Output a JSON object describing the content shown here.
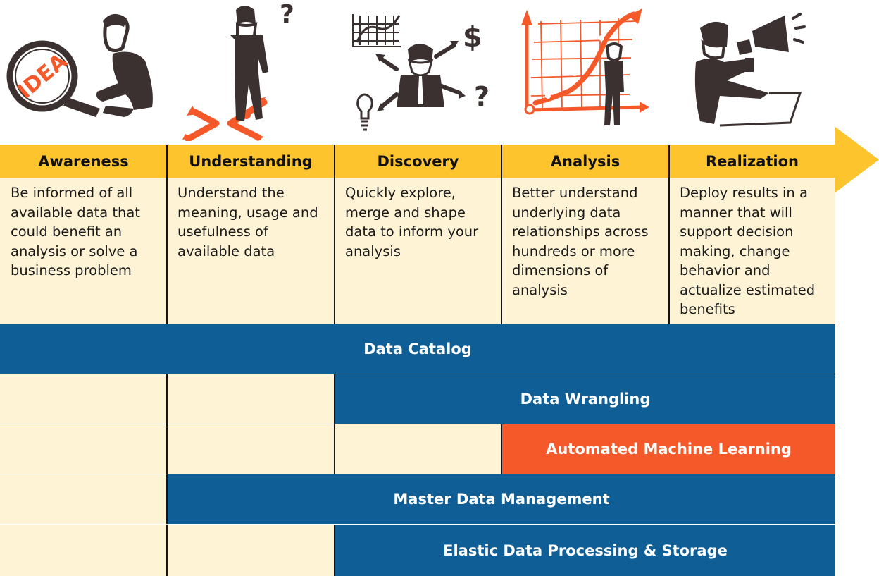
{
  "colors": {
    "header_yellow": "#fdc42e",
    "panel_cream": "#fff3d6",
    "bar_blue": "#0f5f96",
    "bar_orange": "#f5592a",
    "ink": "#3a3130",
    "accent_orange": "#f5592a"
  },
  "illustrations": [
    {
      "name": "magnifier-idea-icon",
      "text": "IDEA"
    },
    {
      "name": "thinking-person-icon",
      "text": "?"
    },
    {
      "name": "person-options-icon",
      "text_dollar": "$",
      "text_question": "?"
    },
    {
      "name": "growth-chart-icon"
    },
    {
      "name": "megaphone-person-icon"
    }
  ],
  "stages": [
    {
      "title": "Awareness",
      "description": "Be informed of all available data that could benefit an analysis or solve a business problem"
    },
    {
      "title": "Understanding",
      "description": "Understand the meaning, usage and usefulness of available data"
    },
    {
      "title": "Discovery",
      "description": "Quickly explore, merge and shape data to inform your analysis"
    },
    {
      "title": "Analysis",
      "description": "Better understand underlying data relationships across hundreds or more dimensions of analysis"
    },
    {
      "title": "Realization",
      "description": "Deploy results in a manner that will support decision making, change behavior and actualize estimated benefits"
    }
  ],
  "capabilities": [
    {
      "label": "Data Catalog",
      "color": "blue",
      "start_stage": "Awareness",
      "end_stage": "Realization"
    },
    {
      "label": "Data Wrangling",
      "color": "blue",
      "start_stage": "Discovery",
      "end_stage": "Realization"
    },
    {
      "label": "Automated Machine Learning",
      "color": "orange",
      "start_stage": "Analysis",
      "end_stage": "Realization"
    },
    {
      "label": "Master Data Management",
      "color": "blue",
      "start_stage": "Understanding",
      "end_stage": "Realization"
    },
    {
      "label": "Elastic Data Processing & Storage",
      "color": "blue",
      "start_stage": "Discovery",
      "end_stage": "Realization"
    }
  ]
}
